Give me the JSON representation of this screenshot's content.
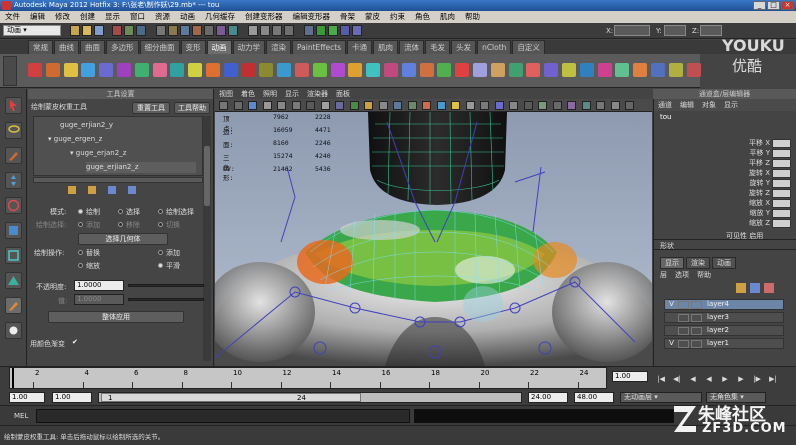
{
  "window": {
    "title": "Autodesk Maya 2012 Hotfix 3: F:\\张老\\制作妖\\29.mb*  ---  tou"
  },
  "menubar": [
    "文件",
    "编辑",
    "修改",
    "创建",
    "显示",
    "窗口",
    "资源",
    "动画",
    "几何缓存",
    "创建变形器",
    "编辑变形器",
    "骨架",
    "蒙皮",
    "约束",
    "角色",
    "肌肉",
    "帮助"
  ],
  "statusline": {
    "mode": "动画",
    "field_x_label": "X:",
    "field_y_label": "Y:",
    "field_z_label": "Z:"
  },
  "shelf": {
    "tabs": [
      "常规",
      "曲线",
      "曲面",
      "多边形",
      "细分曲面",
      "变形",
      "动画",
      "动力学",
      "渲染",
      "PaintEffects",
      "卡通",
      "肌肉",
      "流体",
      "毛发",
      "头发",
      "nCloth",
      "自定义"
    ],
    "active_tab": "动画"
  },
  "tool_settings": {
    "header": "工具设置",
    "tool_name": "绘制蒙皮权重工具",
    "reset_button": "重置工具",
    "help_button": "工具帮助",
    "list_items": [
      "guge_erjian2_y",
      "guge_ergen_z",
      "guge_erjan2_z",
      "guge_erjian2_z"
    ],
    "mode_label": "模式:",
    "mode_options": [
      "绘制",
      "选择",
      "绘制选择"
    ],
    "paint_select_label": "绘制选择:",
    "paint_select_options": [
      "添加",
      "移除",
      "切换"
    ],
    "select_geometry_button": "选择几何体",
    "paint_op_label": "绘制操作:",
    "paint_ops": [
      "替换",
      "添加",
      "缩放",
      "平滑"
    ],
    "opacity_label": "不透明度:",
    "opacity_value": "1.0000",
    "value_label": "值:",
    "value_value": "1.0000",
    "flood_button": "整体应用",
    "color_ramp_label": "用颜色渐变"
  },
  "viewport": {
    "menu": [
      "视图",
      "着色",
      "照明",
      "显示",
      "渲染器",
      "面板"
    ],
    "hud": [
      {
        "label": "顶点:",
        "a": "7962",
        "b": "2228"
      },
      {
        "label": "边:",
        "a": "16059",
        "b": "4471"
      },
      {
        "label": "面:",
        "a": "8160",
        "b": "2246"
      },
      {
        "label": "三角形:",
        "a": "15274",
        "b": "4240"
      },
      {
        "label": "UV:",
        "a": "21462",
        "b": "5436"
      }
    ]
  },
  "channel_box": {
    "title": "通道盒/层编辑器",
    "menu": [
      "通道",
      "编辑",
      "对象",
      "显示"
    ],
    "object": "tou",
    "attributes": [
      "平移 X",
      "平移 Y",
      "平移 Z",
      "旋转 X",
      "旋转 Y",
      "旋转 Z",
      "缩放 X",
      "缩放 Y",
      "缩放 Z"
    ],
    "visibility_label": "可见性",
    "visibility_value": "启用",
    "shapes_label": "形状",
    "layer_tabs": [
      "显示",
      "渲染",
      "动画"
    ],
    "layer_menu": [
      "层",
      "选项",
      "帮助"
    ],
    "layers": [
      {
        "v": "V",
        "name": "layer4",
        "selected": true
      },
      {
        "v": "",
        "name": "layer3",
        "selected": false
      },
      {
        "v": "",
        "name": "layer2",
        "selected": false
      },
      {
        "v": "V",
        "name": "layer1",
        "selected": false
      }
    ]
  },
  "time_slider": {
    "ticks": [
      "2",
      "4",
      "6",
      "8",
      "10",
      "12",
      "14",
      "16",
      "18",
      "20",
      "22",
      "24"
    ],
    "current_frame": "1.00",
    "range_start": "1.00",
    "range_start2": "1.00",
    "range_mid": "1",
    "range_end_inner": "24",
    "range_end": "24.00",
    "range_end2": "48.00",
    "no_anim_layer": "无动画层",
    "no_character": "无角色集"
  },
  "mel": {
    "label": "MEL"
  },
  "help_line": "绘制蒙皮权重工具: 单击后拖动鼠标以绘制所选的关节。",
  "watermark": {
    "youku": "YOUKU",
    "youku_cn": "优酷",
    "site_cn": "朱峰社区",
    "site_url": "ZF3D.COM"
  }
}
